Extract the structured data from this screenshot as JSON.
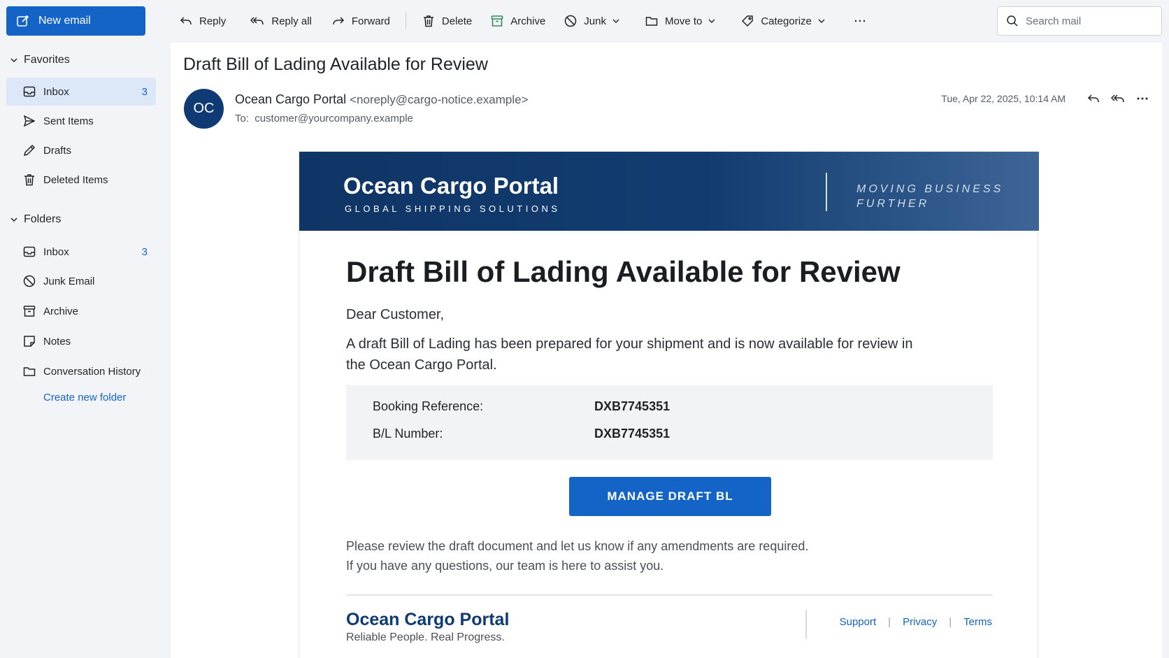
{
  "sidebar": {
    "new_email_label": "New email",
    "favorites": {
      "title": "Favorites",
      "items": [
        {
          "label": "Inbox",
          "count": "3",
          "icon": "inbox-icon"
        },
        {
          "label": "Sent Items",
          "count": "",
          "icon": "send-icon"
        },
        {
          "label": "Drafts",
          "count": "",
          "icon": "pencil-icon"
        },
        {
          "label": "Deleted Items",
          "count": "",
          "icon": "trash-icon"
        }
      ]
    },
    "folders": {
      "title": "Folders",
      "items": [
        {
          "label": "Inbox",
          "count": "3",
          "icon": "inbox-icon"
        },
        {
          "label": "Junk Email",
          "count": "",
          "icon": "block-icon"
        },
        {
          "label": "Archive",
          "count": "",
          "icon": "archive-icon"
        },
        {
          "label": "Notes",
          "count": "",
          "icon": "note-icon"
        },
        {
          "label": "Conversation History",
          "count": "",
          "icon": "folder-icon"
        }
      ]
    },
    "create_folder_label": "Create new folder"
  },
  "toolbar": {
    "reply": "Reply",
    "reply_all": "Reply all",
    "forward": "Forward",
    "delete": "Delete",
    "archive": "Archive",
    "junk": "Junk",
    "move_to": "Move to",
    "categorize": "Categorize",
    "more": "···"
  },
  "search": {
    "placeholder": "Search mail"
  },
  "message": {
    "subject": "Draft Bill of Lading Available for Review",
    "avatar_initials": "OC",
    "sender_name": "Ocean Cargo Portal",
    "sender_email": "<noreply@cargo-notice.example>",
    "to_label": "To:",
    "to_address": "customer@yourcompany.example",
    "date": "Tue, Apr 22, 2025, 10:14 AM"
  },
  "email_body": {
    "brand": "Ocean Cargo Portal",
    "brand_sub": "GLOBAL SHIPPING SOLUTIONS",
    "tagline_line1": "MOVING BUSINESS",
    "tagline_line2": "FURTHER",
    "title": "Draft Bill of Lading Available for Review",
    "greeting": "Dear Customer,",
    "paragraph": "A draft Bill of Lading has been prepared for your shipment and is now available for review in the Ocean Cargo Portal.",
    "refs": [
      {
        "label": "Booking Reference:",
        "value": "DXB7745351"
      },
      {
        "label": "B/L Number:",
        "value": "DXB7745351"
      }
    ],
    "cta": "MANAGE DRAFT BL",
    "note_line1": "Please review the draft document and let us know if any amendments are required.",
    "note_line2": "If you have any questions, our team is here to assist you.",
    "footer_brand": "Ocean Cargo Portal",
    "footer_tagline": "Reliable People. Real Progress.",
    "footer_links": [
      "Support",
      "Privacy",
      "Terms"
    ]
  },
  "colors": {
    "accent": "#1464c8",
    "navy": "#0f3a73",
    "active_item_bg": "#dce8f8"
  }
}
